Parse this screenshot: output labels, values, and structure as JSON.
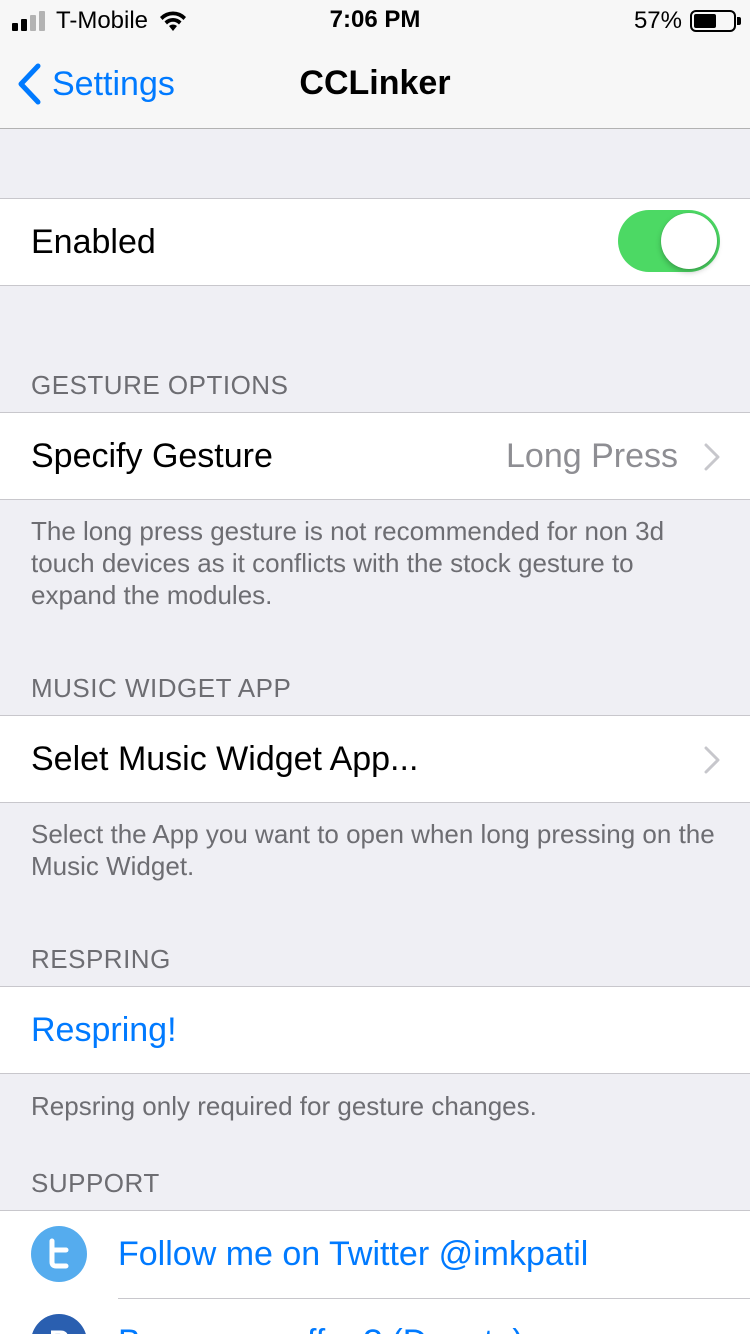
{
  "status_bar": {
    "carrier": "T-Mobile",
    "time": "7:06 PM",
    "battery_percent_label": "57%",
    "battery_level": 0.57,
    "signal_bars_filled": 2,
    "signal_bars_total": 4
  },
  "nav": {
    "back_label": "Settings",
    "title": "CCLinker"
  },
  "enabled": {
    "label": "Enabled",
    "value": true
  },
  "gesture": {
    "header": "GESTURE OPTIONS",
    "row_label": "Specify Gesture",
    "row_value": "Long Press",
    "footer": "The long press gesture is not recommended for non 3d touch devices as it conflicts with the stock gesture to expand the modules."
  },
  "music": {
    "header": "MUSIC WIDGET APP",
    "row_label": "Selet Music Widget App...",
    "footer": "Select the App you want to open when long pressing on the Music Widget."
  },
  "respring": {
    "header": "RESPRING",
    "button_label": "Respring!",
    "footer": "Repsring only required for gesture changes."
  },
  "support": {
    "header": "SUPPORT",
    "twitter_label": "Follow me on Twitter @imkpatil",
    "donate_label": "Buy me a coffee? (Donate)"
  },
  "colors": {
    "accent": "#007aff",
    "toggle_on": "#4cd964",
    "twitter": "#55acee",
    "paypal": "#2a5fb0"
  }
}
